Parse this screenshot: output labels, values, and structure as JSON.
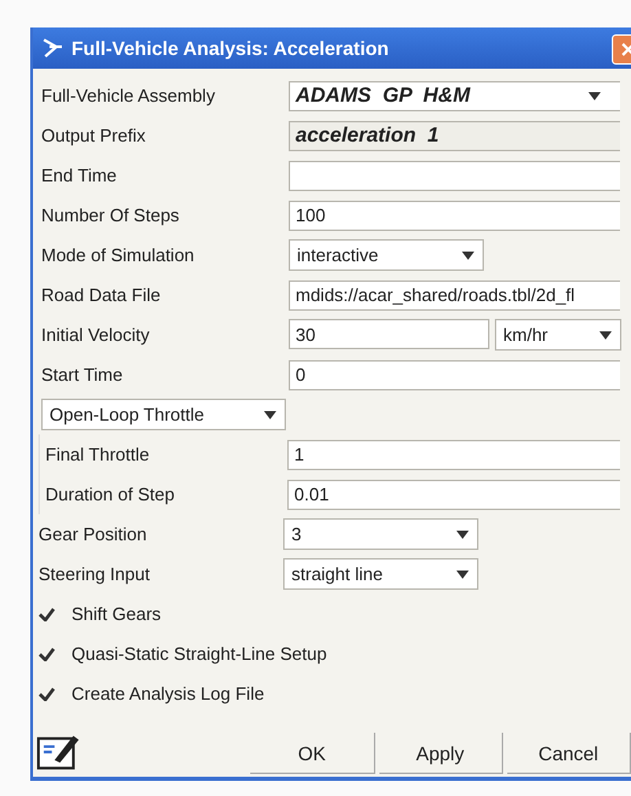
{
  "window": {
    "title": "Full-Vehicle Analysis: Acceleration"
  },
  "fields": [
    {
      "label": "Full-Vehicle Assembly",
      "kind": "combo",
      "value": "ADAMS  GP  H&M"
    },
    {
      "label": "Output Prefix",
      "kind": "emphasis",
      "value": "acceleration  1"
    },
    {
      "label": "End Time",
      "kind": "text"
    },
    {
      "label": "Number Of Steps",
      "kind": "text",
      "value": "100"
    },
    {
      "label": "Mode of Simulation",
      "kind": "dropdown",
      "value": "interactive"
    },
    {
      "label": "Road Data File",
      "kind": "text",
      "value": "mdids://acar_shared/roads.tbl/2d_fl"
    },
    {
      "label": "Initial Velocity",
      "kind": "unit",
      "value": "30",
      "unit": "km/hr"
    },
    {
      "label": "Start Time",
      "kind": "text",
      "value": "0"
    }
  ],
  "throttle_mode": {
    "value": "Open-Loop Throttle"
  },
  "throttle_fields": [
    {
      "label": "Final Throttle",
      "value": "1"
    },
    {
      "label": "Duration of Step",
      "value": "0.01"
    }
  ],
  "gear_fields": [
    {
      "label": "Gear Position",
      "value": "3"
    },
    {
      "label": "Steering Input",
      "value": "straight line"
    }
  ],
  "checkboxes": [
    {
      "label": "Shift Gears",
      "checked": true
    },
    {
      "label": "Quasi-Static Straight-Line Setup",
      "checked": true
    },
    {
      "label": "Create Analysis Log File",
      "checked": true
    }
  ],
  "buttons": [
    "OK",
    "Apply",
    "Cancel"
  ]
}
